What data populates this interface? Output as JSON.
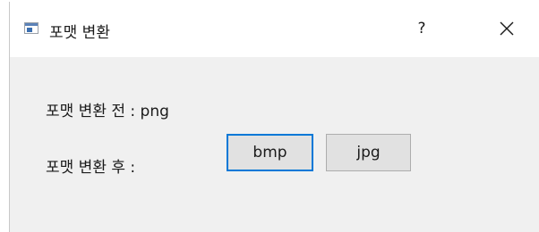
{
  "window": {
    "title": "포맷 변환",
    "help_label": "?",
    "app_icon": "window-app-icon",
    "close_icon": "close-icon"
  },
  "form": {
    "before_label": "포맷 변환 전 :",
    "before_value": "png",
    "after_label": "포맷 변환 후 :"
  },
  "buttons": {
    "bmp_label": "bmp",
    "jpg_label": "jpg"
  },
  "colors": {
    "focus_border": "#0078d7",
    "button_bg": "#e1e1e1",
    "dialog_bg": "#f0f0f0"
  }
}
